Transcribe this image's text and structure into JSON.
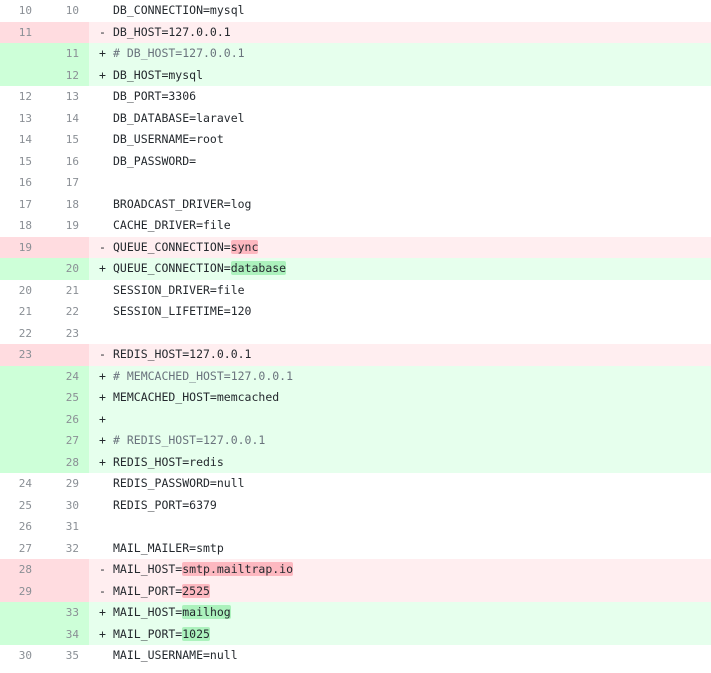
{
  "rows": [
    {
      "type": "ctx",
      "old": "10",
      "new": "10",
      "sign": "",
      "text": "DB_CONNECTION=mysql"
    },
    {
      "type": "del",
      "old": "11",
      "new": "",
      "sign": "-",
      "text": "DB_HOST=127.0.0.1"
    },
    {
      "type": "add",
      "old": "",
      "new": "11",
      "sign": "+",
      "text": "# DB_HOST=127.0.0.1",
      "comment": true
    },
    {
      "type": "add",
      "old": "",
      "new": "12",
      "sign": "+",
      "text": "DB_HOST=mysql"
    },
    {
      "type": "ctx",
      "old": "12",
      "new": "13",
      "sign": "",
      "text": "DB_PORT=3306"
    },
    {
      "type": "ctx",
      "old": "13",
      "new": "14",
      "sign": "",
      "text": "DB_DATABASE=laravel"
    },
    {
      "type": "ctx",
      "old": "14",
      "new": "15",
      "sign": "",
      "text": "DB_USERNAME=root"
    },
    {
      "type": "ctx",
      "old": "15",
      "new": "16",
      "sign": "",
      "text": "DB_PASSWORD="
    },
    {
      "type": "ctx",
      "old": "16",
      "new": "17",
      "sign": "",
      "text": ""
    },
    {
      "type": "ctx",
      "old": "17",
      "new": "18",
      "sign": "",
      "text": "BROADCAST_DRIVER=log"
    },
    {
      "type": "ctx",
      "old": "18",
      "new": "19",
      "sign": "",
      "text": "CACHE_DRIVER=file"
    },
    {
      "type": "del",
      "old": "19",
      "new": "",
      "sign": "-",
      "text": "QUEUE_CONNECTION=",
      "hl": "sync"
    },
    {
      "type": "add",
      "old": "",
      "new": "20",
      "sign": "+",
      "text": "QUEUE_CONNECTION=",
      "hl": "database"
    },
    {
      "type": "ctx",
      "old": "20",
      "new": "21",
      "sign": "",
      "text": "SESSION_DRIVER=file"
    },
    {
      "type": "ctx",
      "old": "21",
      "new": "22",
      "sign": "",
      "text": "SESSION_LIFETIME=120"
    },
    {
      "type": "ctx",
      "old": "22",
      "new": "23",
      "sign": "",
      "text": ""
    },
    {
      "type": "del",
      "old": "23",
      "new": "",
      "sign": "-",
      "text": "REDIS_HOST=127.0.0.1"
    },
    {
      "type": "add",
      "old": "",
      "new": "24",
      "sign": "+",
      "text": "# MEMCACHED_HOST=127.0.0.1",
      "comment": true
    },
    {
      "type": "add",
      "old": "",
      "new": "25",
      "sign": "+",
      "text": "MEMCACHED_HOST=memcached"
    },
    {
      "type": "add",
      "old": "",
      "new": "26",
      "sign": "+",
      "text": ""
    },
    {
      "type": "add",
      "old": "",
      "new": "27",
      "sign": "+",
      "text": "# REDIS_HOST=127.0.0.1",
      "comment": true
    },
    {
      "type": "add",
      "old": "",
      "new": "28",
      "sign": "+",
      "text": "REDIS_HOST=redis"
    },
    {
      "type": "ctx",
      "old": "24",
      "new": "29",
      "sign": "",
      "text": "REDIS_PASSWORD=null"
    },
    {
      "type": "ctx",
      "old": "25",
      "new": "30",
      "sign": "",
      "text": "REDIS_PORT=6379"
    },
    {
      "type": "ctx",
      "old": "26",
      "new": "31",
      "sign": "",
      "text": ""
    },
    {
      "type": "ctx",
      "old": "27",
      "new": "32",
      "sign": "",
      "text": "MAIL_MAILER=smtp"
    },
    {
      "type": "del",
      "old": "28",
      "new": "",
      "sign": "-",
      "text": "MAIL_HOST=",
      "hl": "smtp.mailtrap.io"
    },
    {
      "type": "del",
      "old": "29",
      "new": "",
      "sign": "-",
      "text": "MAIL_PORT=",
      "hl": "2525"
    },
    {
      "type": "add",
      "old": "",
      "new": "33",
      "sign": "+",
      "text": "MAIL_HOST=",
      "hl": "mailhog"
    },
    {
      "type": "add",
      "old": "",
      "new": "34",
      "sign": "+",
      "text": "MAIL_PORT=",
      "hl": "1025"
    },
    {
      "type": "ctx",
      "old": "30",
      "new": "35",
      "sign": "",
      "text": "MAIL_USERNAME=null"
    }
  ],
  "colors": {
    "del_gutter": "#ffdce0",
    "del_line": "#ffeef0",
    "del_highlight": "#fdb8c0",
    "add_gutter": "#cdffd8",
    "add_line": "#e6ffed",
    "add_highlight": "#acf2bd"
  }
}
